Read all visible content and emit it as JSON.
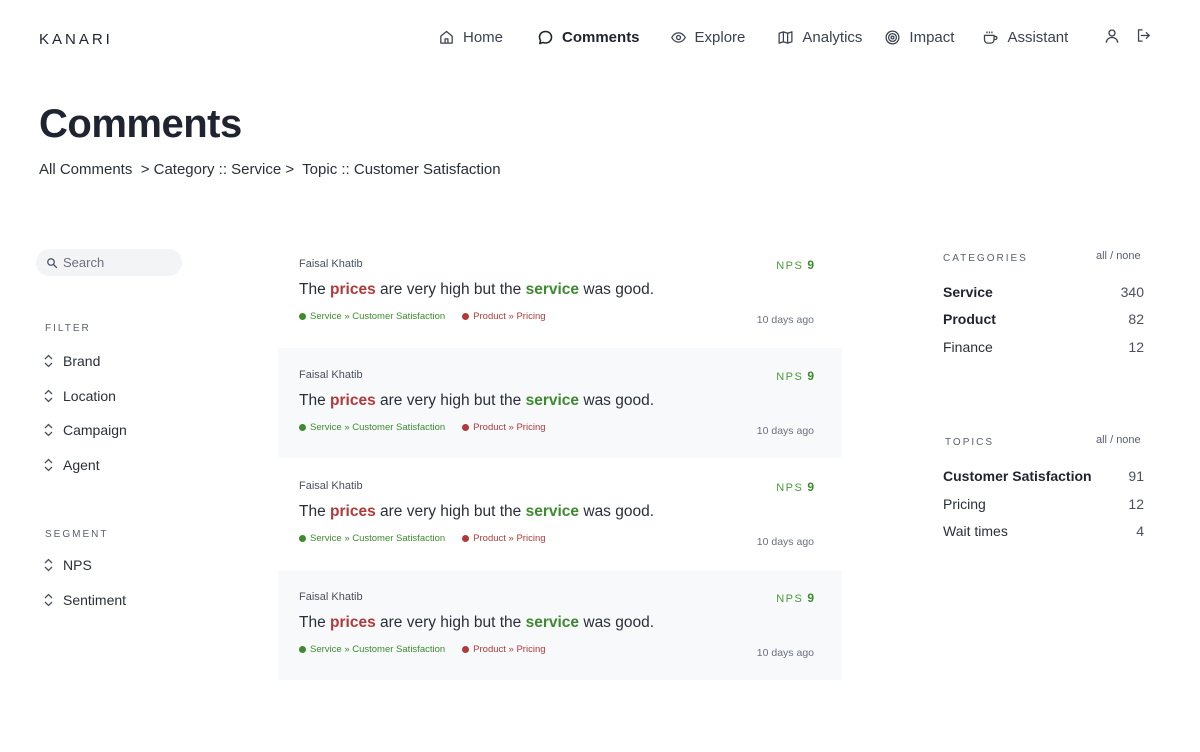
{
  "header": {
    "logo": "KANARI",
    "nav": [
      {
        "label": "Home",
        "icon": "home-icon"
      },
      {
        "label": "Comments",
        "icon": "chat-bubble-icon",
        "active": true
      },
      {
        "label": "Explore",
        "icon": "eye-icon"
      },
      {
        "label": "Analytics",
        "icon": "map-icon"
      },
      {
        "label": "Impact",
        "icon": "target-icon"
      },
      {
        "label": "Assistant",
        "icon": "coffee-cup-icon"
      }
    ],
    "user_icon": "user-icon",
    "logout_icon": "logout-icon"
  },
  "page": {
    "title": "Comments",
    "breadcrumb": [
      "All Comments",
      "  > Category :: Service > ",
      " Topic :: Customer Satisfaction"
    ]
  },
  "sidebar": {
    "search_placeholder": "Search",
    "filter_label": "FILTER",
    "filters": [
      "Brand",
      "Location",
      "Campaign",
      "Agent"
    ],
    "segment_label": "SEGMENT",
    "segments": [
      "NPS",
      "Sentiment"
    ]
  },
  "comments": [
    {
      "author": "Faisal Khatib",
      "nps_label": "NPS",
      "nps_value": "9",
      "text": {
        "p1": "The ",
        "w1": "prices",
        "p2": " are very high but the ",
        "w2": "service",
        "p3": " was good."
      },
      "tags": [
        "Service » Customer Satisfaction",
        "Product » Pricing"
      ],
      "time": "10 days ago"
    },
    {
      "author": "Faisal Khatib",
      "nps_label": "NPS",
      "nps_value": "9",
      "text": {
        "p1": "The ",
        "w1": "prices",
        "p2": " are very high but the ",
        "w2": "service",
        "p3": " was good."
      },
      "tags": [
        "Service » Customer Satisfaction",
        "Product » Pricing"
      ],
      "time": "10 days ago"
    },
    {
      "author": "Faisal Khatib",
      "nps_label": "NPS",
      "nps_value": "9",
      "text": {
        "p1": "The ",
        "w1": "prices",
        "p2": " are very high but the ",
        "w2": "service",
        "p3": " was good."
      },
      "tags": [
        "Service » Customer Satisfaction",
        "Product » Pricing"
      ],
      "time": "10 days ago"
    },
    {
      "author": "Faisal Khatib",
      "nps_label": "NPS",
      "nps_value": "9",
      "text": {
        "p1": "The ",
        "w1": "prices",
        "p2": " are very high but the ",
        "w2": "service",
        "p3": " was good."
      },
      "tags": [
        "Service » Customer Satisfaction",
        "Product » Pricing"
      ],
      "time": "10 days ago"
    }
  ],
  "categories": {
    "label": "CATEGORIES",
    "all": "all",
    "sep": " / ",
    "none": "none",
    "items": [
      {
        "name": "Service",
        "count": "340",
        "selected": true
      },
      {
        "name": "Product",
        "count": "82",
        "selected": true
      },
      {
        "name": "Finance",
        "count": "12",
        "selected": false
      }
    ]
  },
  "topics": {
    "label": "TOPICS",
    "all": "all",
    "sep": " / ",
    "none": "none",
    "items": [
      {
        "name": "Customer Satisfaction",
        "count": "91",
        "selected": true
      },
      {
        "name": "Pricing",
        "count": "12",
        "selected": false
      },
      {
        "name": "Wait times",
        "count": "4",
        "selected": false
      }
    ]
  },
  "colors": {
    "negative": "#b03a3a",
    "positive": "#3d8a2f",
    "alt_row": "#f8f9fb"
  }
}
